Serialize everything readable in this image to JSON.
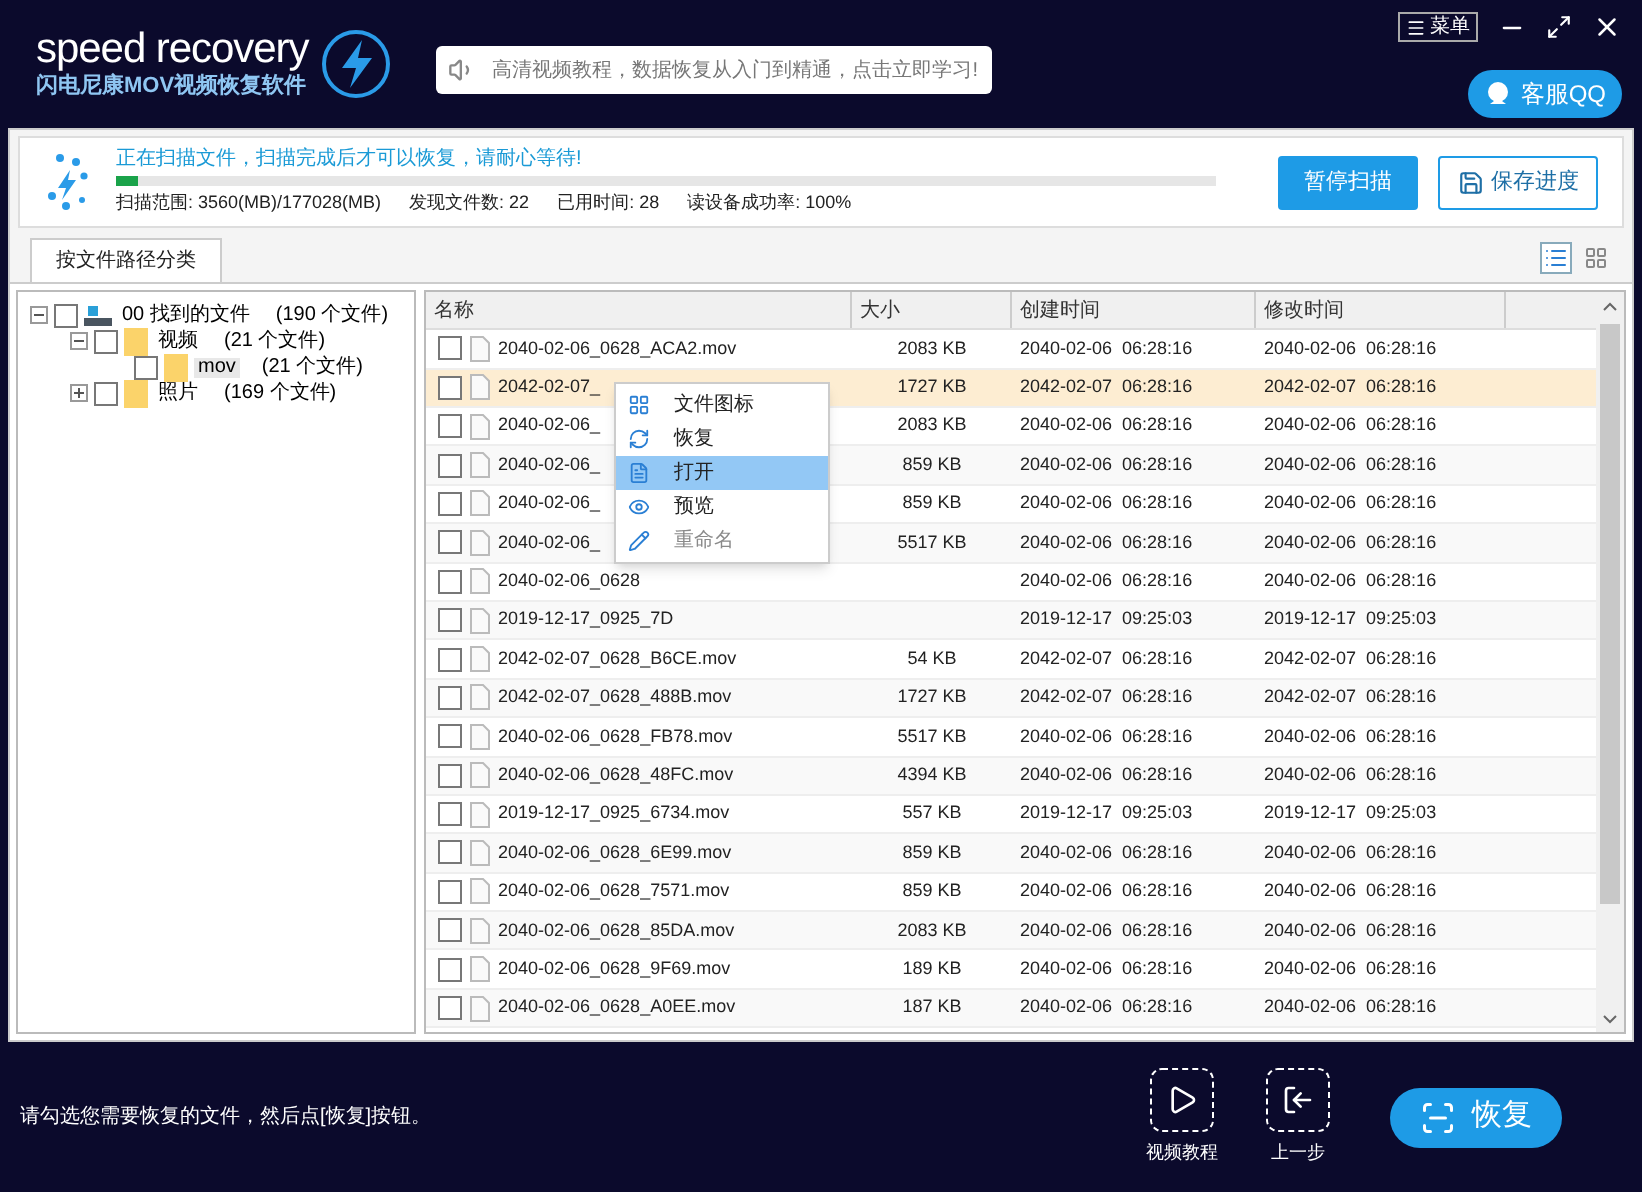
{
  "header": {
    "logo": "speed recovery",
    "subtitle": "闪电尼康MOV视频恢复软件",
    "notice": "高清视频教程，数据恢复从入门到精通，点击立即学习!",
    "menu_button": "菜单",
    "support_button": "客服QQ"
  },
  "scan": {
    "message": "正在扫描文件，扫描完成后才可以恢复，请耐心等待!",
    "level": 0.02,
    "stats": [
      "扫描范围: 3560(MB)/177028(MB)",
      "发现文件数: 22",
      "已用时间: 28",
      "读设备成功率: 100%"
    ],
    "pause_button": "暂停扫描",
    "save_button": "保存进度"
  },
  "tabs": [
    {
      "label": "按文件路径分类",
      "selected": true
    }
  ],
  "views": [
    {
      "kind": "list",
      "selected": true
    },
    {
      "kind": "grid",
      "selected": false
    }
  ],
  "tree": [
    {
      "label": "00 找到的文件",
      "count": "(190 个文件)",
      "checked": false,
      "expanded": true,
      "kind": "drive",
      "children": [
        {
          "label": "视频",
          "count": "(21 个文件)",
          "checked": false,
          "expanded": true,
          "kind": "folder",
          "children": [
            {
              "label": "mov",
              "count": "(21 个文件)",
              "checked": false,
              "selected": true,
              "kind": "folder"
            }
          ]
        },
        {
          "label": "照片",
          "count": "(169 个文件)",
          "checked": false,
          "expanded": false,
          "kind": "folder"
        }
      ]
    }
  ],
  "table": {
    "columns": [
      "名称",
      "大小",
      "创建时间",
      "修改时间"
    ],
    "rows": [
      {
        "name": "2040-02-06_0628_ACA2.mov",
        "size": "2083 KB",
        "created": "2040-02-06  06:28:16",
        "modified": "2040-02-06  06:28:16",
        "checked": false,
        "selected": false
      },
      {
        "name": "2042-02-07_",
        "size": "1727 KB",
        "created": "2042-02-07  06:28:16",
        "modified": "2042-02-07  06:28:16",
        "checked": false,
        "selected": true
      },
      {
        "name": "2040-02-06_",
        "size": "2083 KB",
        "created": "2040-02-06  06:28:16",
        "modified": "2040-02-06  06:28:16",
        "checked": false,
        "selected": false
      },
      {
        "name": "2040-02-06_",
        "size": "859 KB",
        "created": "2040-02-06  06:28:16",
        "modified": "2040-02-06  06:28:16",
        "checked": false,
        "selected": false
      },
      {
        "name": "2040-02-06_",
        "size": "859 KB",
        "created": "2040-02-06  06:28:16",
        "modified": "2040-02-06  06:28:16",
        "checked": false,
        "selected": false
      },
      {
        "name": "2040-02-06_",
        "size": "5517 KB",
        "created": "2040-02-06  06:28:16",
        "modified": "2040-02-06  06:28:16",
        "checked": false,
        "selected": false
      },
      {
        "name": "2040-02-06_0628",
        "created": "2040-02-06  06:28:16",
        "modified": "2040-02-06  06:28:16",
        "checked": false,
        "selected": false
      },
      {
        "name": "2019-12-17_0925_7D",
        "created": "2019-12-17  09:25:03",
        "modified": "2019-12-17  09:25:03",
        "checked": false,
        "selected": false
      },
      {
        "name": "2042-02-07_0628_B6CE.mov",
        "size": "54 KB",
        "created": "2042-02-07  06:28:16",
        "modified": "2042-02-07  06:28:16",
        "checked": false,
        "selected": false
      },
      {
        "name": "2042-02-07_0628_488B.mov",
        "size": "1727 KB",
        "created": "2042-02-07  06:28:16",
        "modified": "2042-02-07  06:28:16",
        "checked": false,
        "selected": false
      },
      {
        "name": "2040-02-06_0628_FB78.mov",
        "size": "5517 KB",
        "created": "2040-02-06  06:28:16",
        "modified": "2040-02-06  06:28:16",
        "checked": false,
        "selected": false
      },
      {
        "name": "2040-02-06_0628_48FC.mov",
        "size": "4394 KB",
        "created": "2040-02-06  06:28:16",
        "modified": "2040-02-06  06:28:16",
        "checked": false,
        "selected": false
      },
      {
        "name": "2019-12-17_0925_6734.mov",
        "size": "557 KB",
        "created": "2019-12-17  09:25:03",
        "modified": "2019-12-17  09:25:03",
        "checked": false,
        "selected": false
      },
      {
        "name": "2040-02-06_0628_6E99.mov",
        "size": "859 KB",
        "created": "2040-02-06  06:28:16",
        "modified": "2040-02-06  06:28:16",
        "checked": false,
        "selected": false
      },
      {
        "name": "2040-02-06_0628_7571.mov",
        "size": "859 KB",
        "created": "2040-02-06  06:28:16",
        "modified": "2040-02-06  06:28:16",
        "checked": false,
        "selected": false
      },
      {
        "name": "2040-02-06_0628_85DA.mov",
        "size": "2083 KB",
        "created": "2040-02-06  06:28:16",
        "modified": "2040-02-06  06:28:16",
        "checked": false,
        "selected": false
      },
      {
        "name": "2040-02-06_0628_9F69.mov",
        "size": "189 KB",
        "created": "2040-02-06  06:28:16",
        "modified": "2040-02-06  06:28:16",
        "checked": false,
        "selected": false
      },
      {
        "name": "2040-02-06_0628_A0EE.mov",
        "size": "187 KB",
        "created": "2040-02-06  06:28:16",
        "modified": "2040-02-06  06:28:16",
        "checked": false,
        "selected": false
      }
    ]
  },
  "context_menu": [
    {
      "label": "文件图标",
      "kind": "grid",
      "selected": false,
      "disabled": false
    },
    {
      "label": "恢复",
      "kind": "restore",
      "selected": false,
      "disabled": false
    },
    {
      "label": "打开",
      "kind": "open",
      "selected": true,
      "disabled": false
    },
    {
      "label": "预览",
      "kind": "preview",
      "selected": false,
      "disabled": false
    },
    {
      "label": "重命名",
      "kind": "rename",
      "selected": false,
      "disabled": true
    }
  ],
  "footer": {
    "hint": "请勾选您需要恢复的文件，然后点[恢复]按钮。",
    "actions": [
      {
        "label": "视频教程",
        "kind": "play"
      },
      {
        "label": "上一步",
        "kind": "back"
      }
    ],
    "restore_button": "恢复"
  }
}
